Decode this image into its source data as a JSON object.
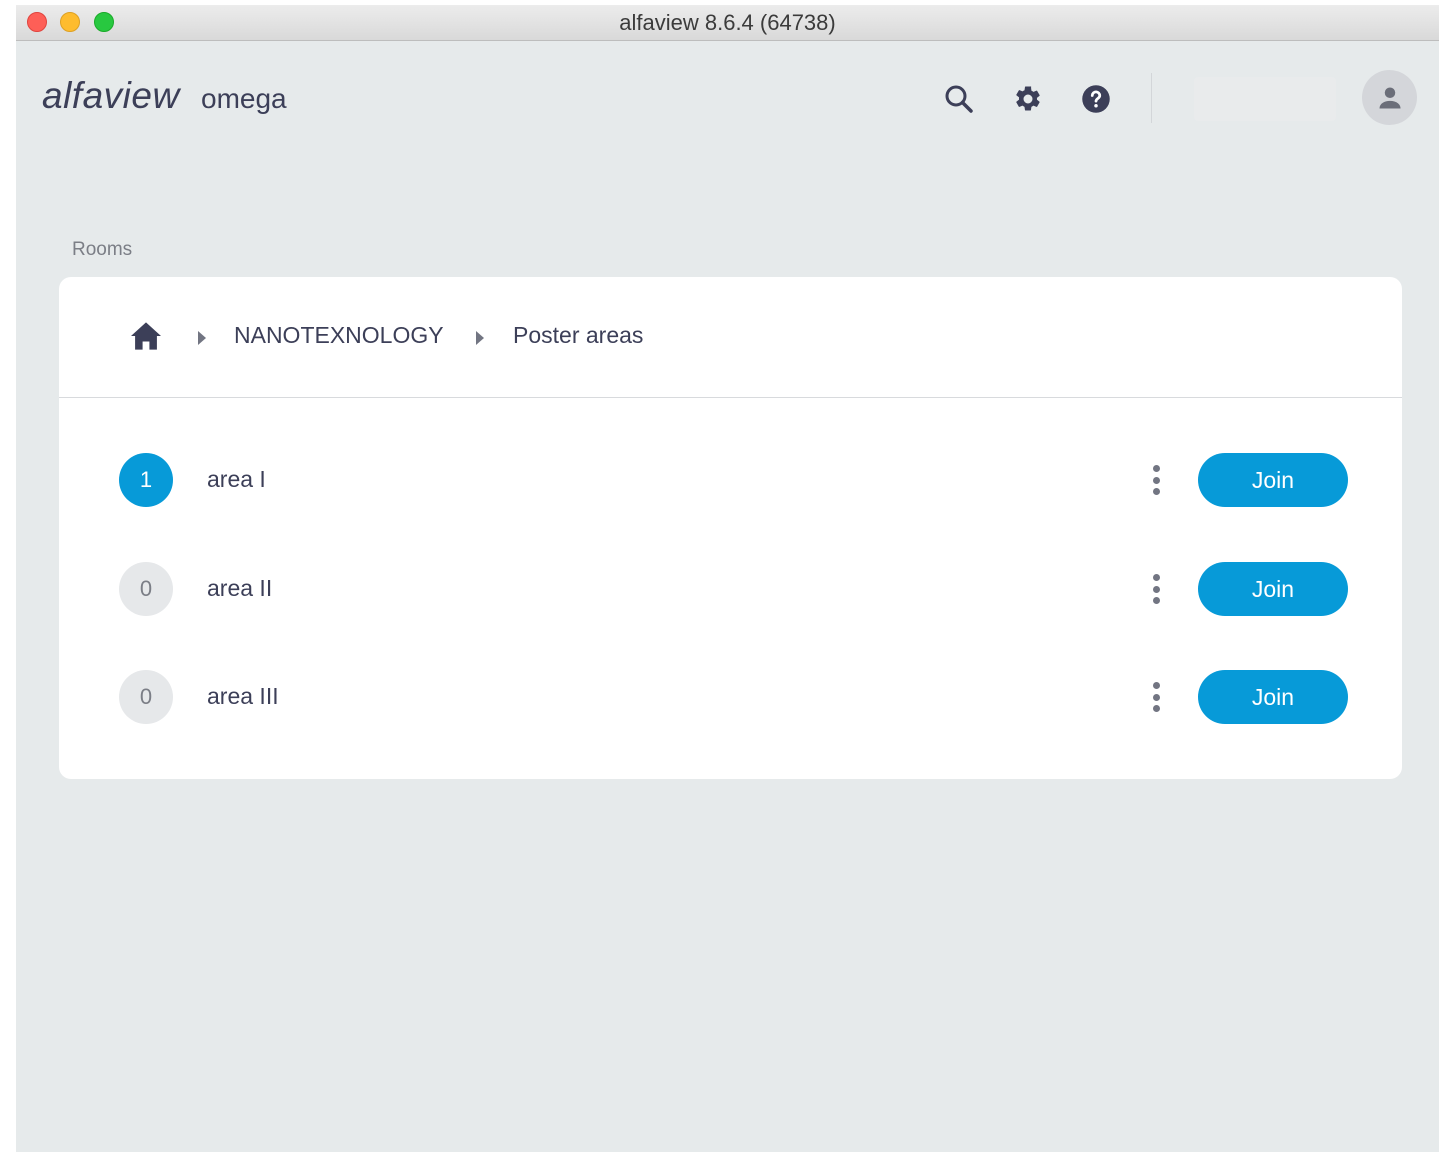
{
  "window": {
    "title": "alfaview 8.6.4 (64738)"
  },
  "header": {
    "logo": "alfaview",
    "tenant": "omega",
    "icons": [
      "search-icon",
      "gear-icon",
      "help-icon",
      "user-icon"
    ]
  },
  "rooms": {
    "section_label": "Rooms",
    "breadcrumb": {
      "home_icon": "home-icon",
      "items": [
        "NANOTEXNOLOGY",
        "Poster areas"
      ]
    },
    "list": [
      {
        "count": "1",
        "name": "area I",
        "active": true,
        "join_label": "Join"
      },
      {
        "count": "0",
        "name": "area II",
        "active": false,
        "join_label": "Join"
      },
      {
        "count": "0",
        "name": "area III",
        "active": false,
        "join_label": "Join"
      }
    ]
  },
  "colors": {
    "accent": "#079ad8",
    "background": "#e6eaeb",
    "text": "#3c3f58"
  }
}
